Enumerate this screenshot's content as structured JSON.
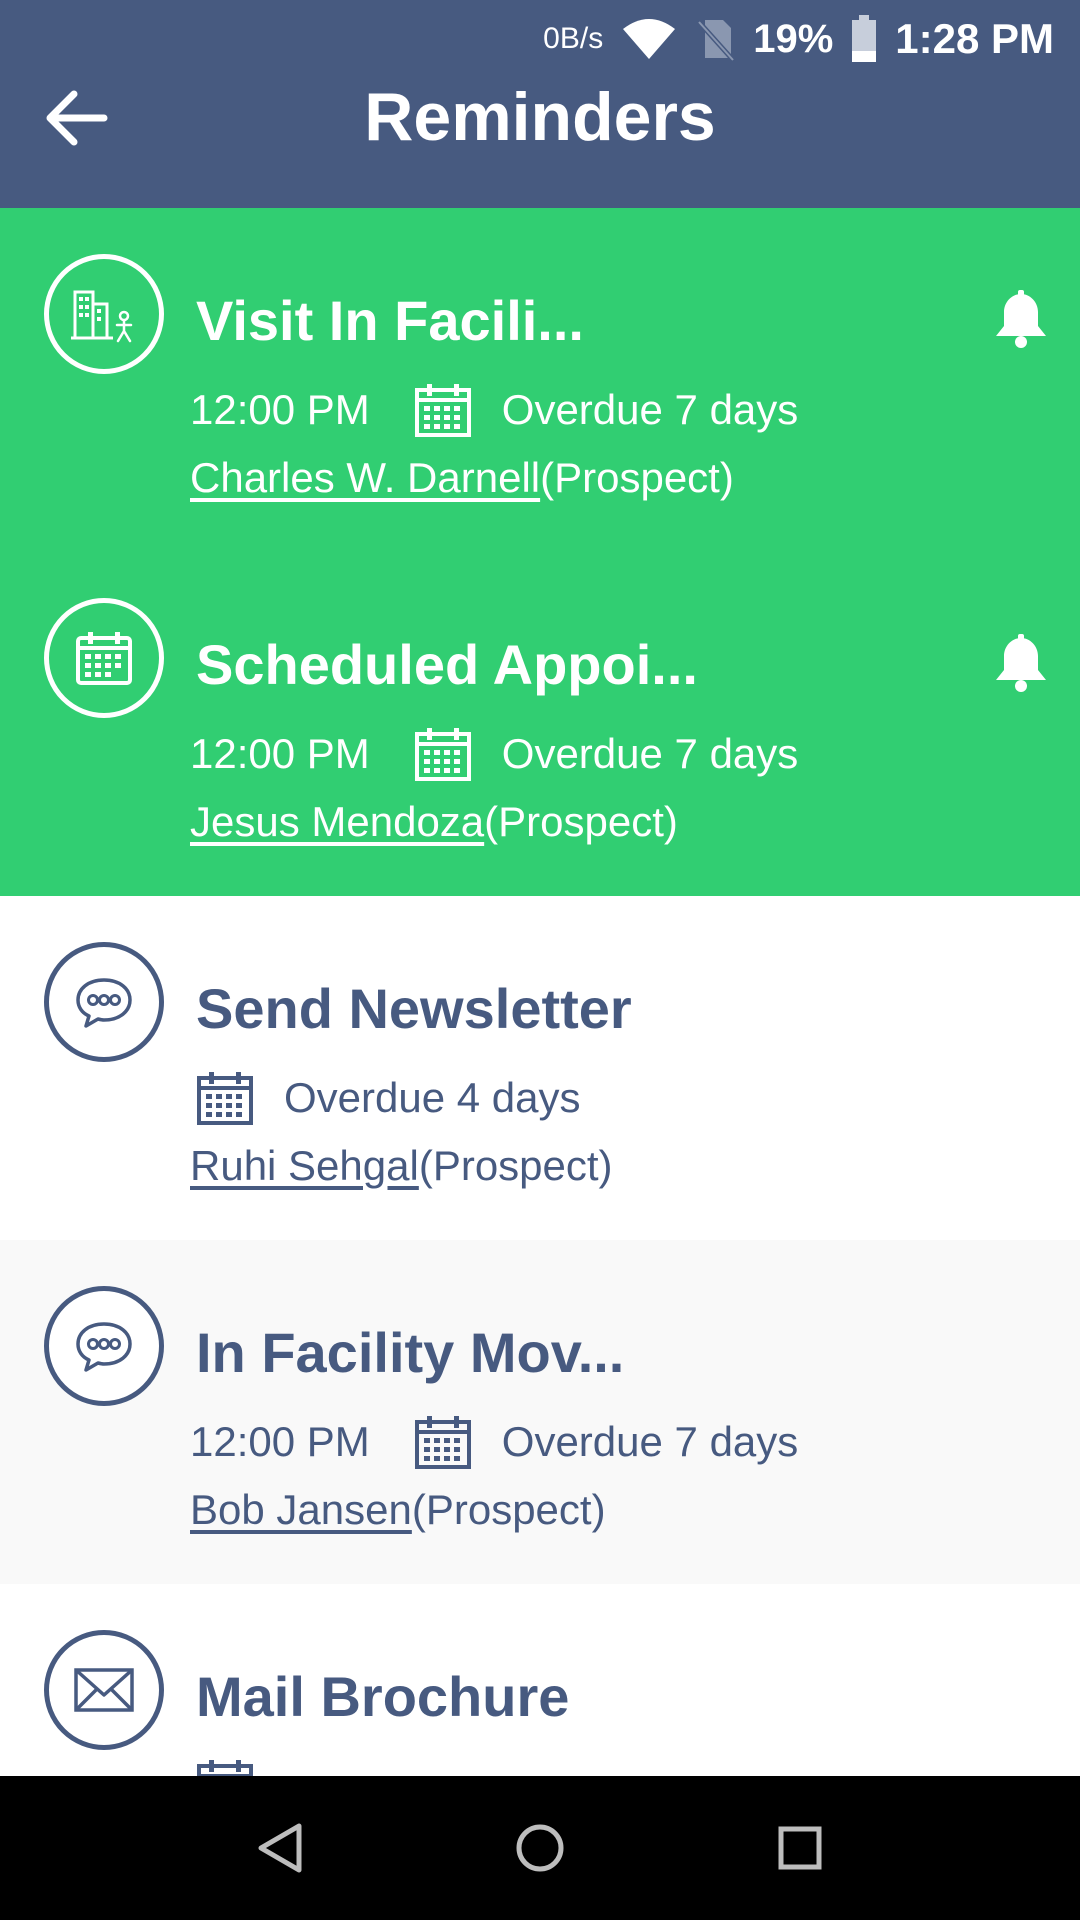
{
  "status_bar": {
    "speed": "0B/s",
    "battery": "19%",
    "time": "1:28 PM"
  },
  "header": {
    "title": "Reminders"
  },
  "colors": {
    "header_bg": "#475a80",
    "highlight": "#31ce72",
    "text": "#475a80"
  },
  "reminders": [
    {
      "title": "Visit In Facili...",
      "time": "12:00 PM",
      "due": "Overdue 7 days",
      "contact": "Charles W. Darnell",
      "contact_type": "(Prospect)",
      "icon": "building-person-icon",
      "has_bell": true
    },
    {
      "title": "Scheduled Appoi...",
      "time": "12:00 PM",
      "due": "Overdue 7 days",
      "contact": "Jesus Mendoza",
      "contact_type": "(Prospect)",
      "icon": "calendar-icon",
      "has_bell": true
    },
    {
      "title": "Send Newsletter",
      "time": "",
      "due": "Overdue 4 days",
      "contact": "Ruhi Sehgal",
      "contact_type": "(Prospect)",
      "icon": "chat-bubble-icon",
      "has_bell": false
    },
    {
      "title": "In Facility Mov...",
      "time": "12:00 PM",
      "due": "Overdue 7 days",
      "contact": "Bob Jansen",
      "contact_type": "(Prospect)",
      "icon": "chat-bubble-icon",
      "has_bell": false
    },
    {
      "title": "Mail Brochure",
      "time": "",
      "due": "",
      "contact": "",
      "contact_type": "",
      "icon": "envelope-icon",
      "has_bell": false
    }
  ]
}
